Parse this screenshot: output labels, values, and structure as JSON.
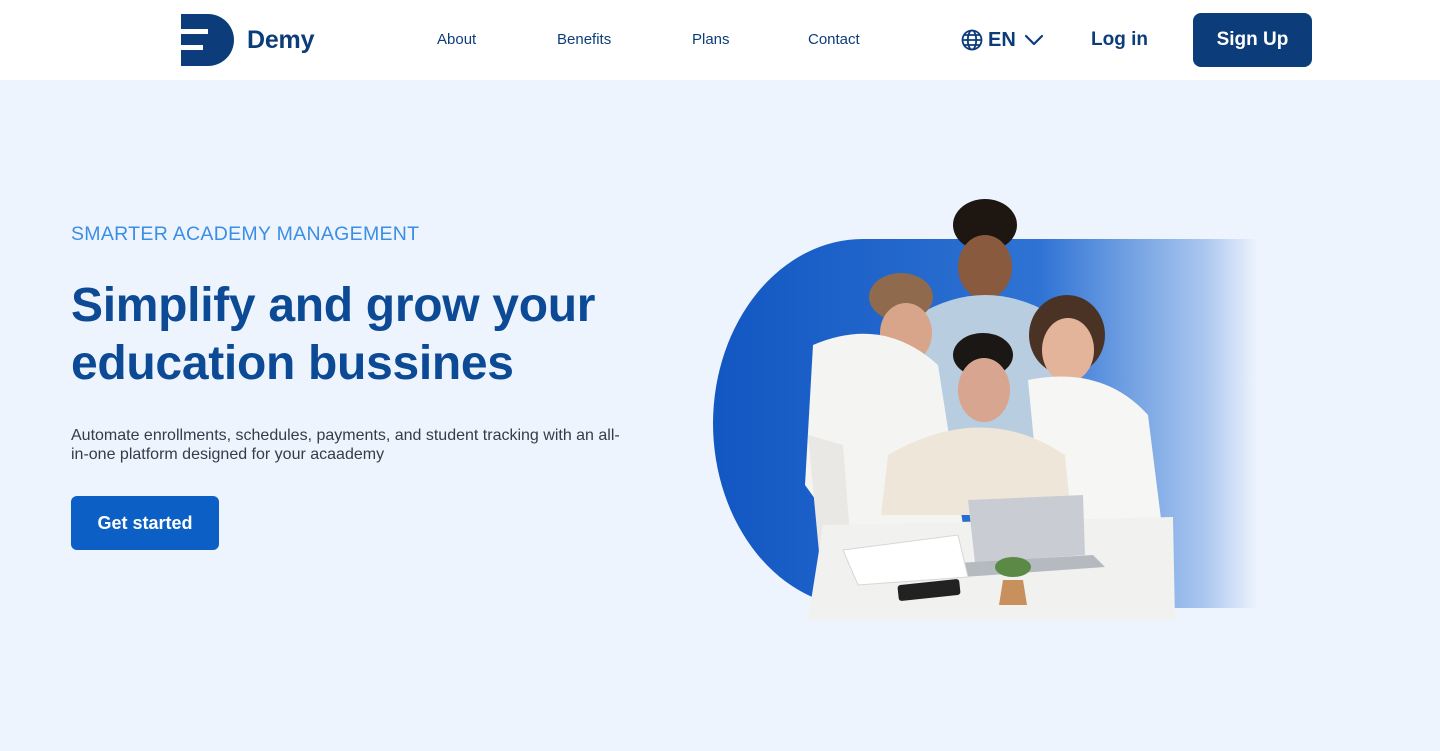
{
  "brand": {
    "name": "Demy",
    "primary_color": "#0c3d7a",
    "accent_color": "#0c5fc4",
    "eyebrow_color": "#3b8ee6",
    "background_color": "#eef4fd"
  },
  "nav": {
    "items": [
      {
        "label": "About"
      },
      {
        "label": "Benefits"
      },
      {
        "label": "Plans"
      },
      {
        "label": "Contact"
      }
    ]
  },
  "language": {
    "icon": "globe-icon",
    "code": "EN",
    "dropdown_icon": "chevron-down-icon"
  },
  "auth": {
    "login_label": "Log in",
    "signup_label": "Sign Up"
  },
  "hero": {
    "eyebrow": "SMARTER ACADEMY MANAGEMENT",
    "headline_line1": "Simplify and grow your",
    "headline_line2": "education bussines",
    "subtext": "Automate enrollments, schedules, payments, and student tracking with an all-in-one platform designed for your acaademy",
    "cta_label": "Get started"
  }
}
